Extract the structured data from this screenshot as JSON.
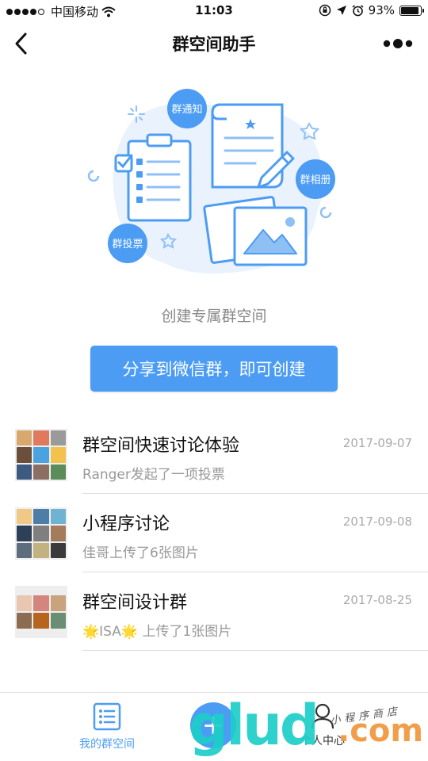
{
  "status_bar": {
    "carrier": "中国移动",
    "time": "11:03",
    "battery_percent": "93%",
    "battery_level": 0.93,
    "icons": [
      "signal-dots-icon",
      "wifi-icon",
      "rotation-lock-icon",
      "location-arrow-icon",
      "alarm-icon",
      "battery-icon"
    ]
  },
  "nav": {
    "title": "群空间助手",
    "back_icon": "chevron-left-icon",
    "more_icon": "more-dots-icon"
  },
  "hero": {
    "bubbles": {
      "notice": "群通知",
      "album": "群相册",
      "vote": "群投票"
    },
    "caption": "创建专属群空间",
    "share_label": "分享到微信群，即可创建"
  },
  "groups": [
    {
      "name": "群空间快速讨论体验",
      "date": "2017-09-07",
      "activity": "Ranger发起了一项投票"
    },
    {
      "name": "小程序讨论",
      "date": "2017-09-08",
      "activity": "佳哥上传了6张图片"
    },
    {
      "name": "群空间设计群",
      "date": "2017-08-25",
      "activity_prefix": "🌟",
      "activity_name": "ISA",
      "activity_suffix": "🌟 上传了1张图片"
    }
  ],
  "tab_bar": {
    "my_groups_label": "我的群空间",
    "add_icon": "plus-icon",
    "me_label": "个人中心"
  },
  "watermark": {
    "brand": "glud",
    "domain": ".com",
    "tagline": "小程序商店"
  },
  "colors": {
    "accent": "#4c9cf4",
    "divider": "#dedede"
  }
}
